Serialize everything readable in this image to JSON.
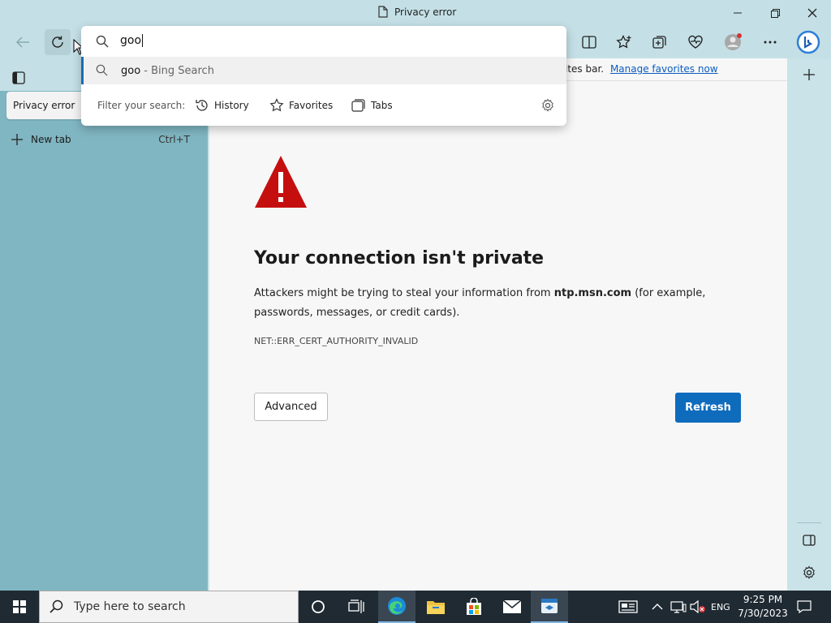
{
  "window": {
    "title": "Privacy error"
  },
  "omnibox": {
    "query": "goo",
    "suggestion_query": "goo",
    "suggestion_source": " - Bing Search",
    "filter_label": "Filter your search:",
    "filters": [
      "History",
      "Favorites",
      "Tabs"
    ]
  },
  "favorites_bar": {
    "text_fragment": "ites bar.",
    "link": "Manage favorites now"
  },
  "sidebar": {
    "tab_label": "Privacy error",
    "new_tab_label": "New tab",
    "new_tab_shortcut": "Ctrl+T"
  },
  "error": {
    "title": "Your connection isn't private",
    "desc_before": "Attackers might be trying to steal your information from ",
    "desc_host": "ntp.msn.com",
    "desc_after": " (for example, passwords, messages, or credit cards).",
    "code": "NET::ERR_CERT_AUTHORITY_INVALID",
    "advanced_label": "Advanced",
    "refresh_label": "Refresh"
  },
  "colors": {
    "accent": "#0f6cbd",
    "warning": "#c50f0f",
    "sidebar": "#80b6c2"
  },
  "taskbar": {
    "search_placeholder": "Type here to search",
    "language": "ENG",
    "time": "9:25 PM",
    "date": "7/30/2023"
  }
}
